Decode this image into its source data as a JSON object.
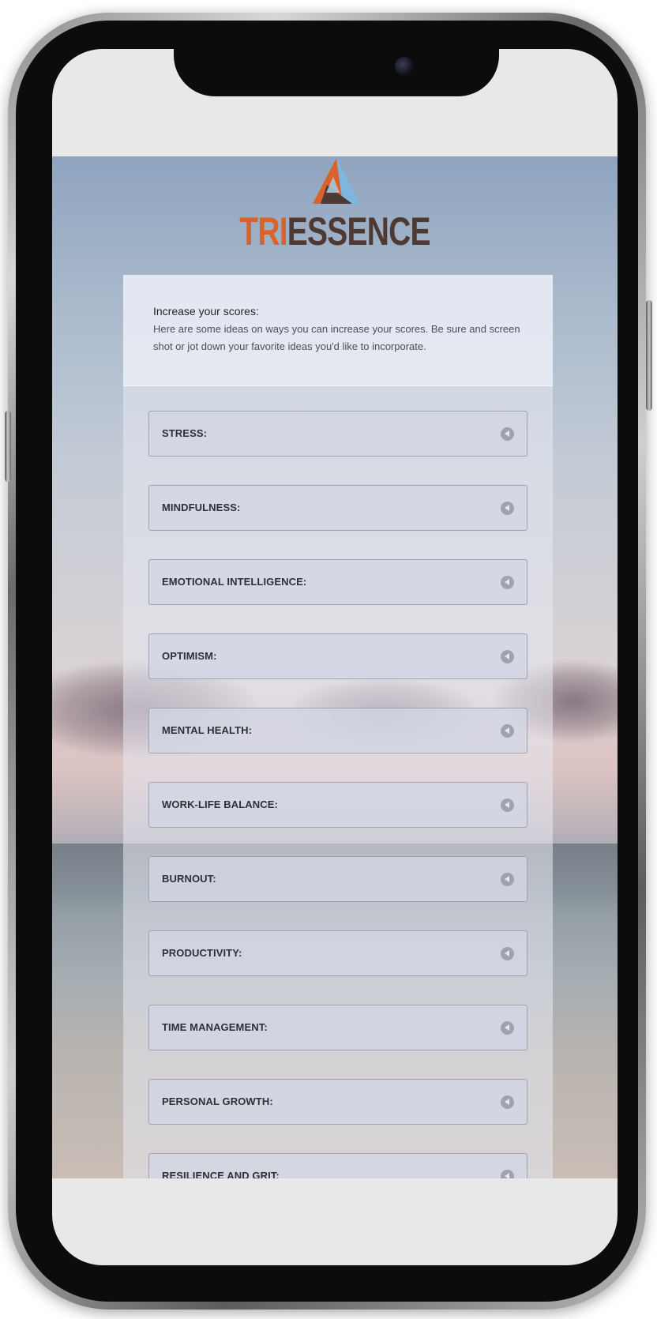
{
  "brand": {
    "name_part1": "TRI",
    "name_part2": "ESSENCE",
    "colors": {
      "accent_orange": "#d8642c",
      "accent_blue": "#7fb6e0",
      "brown": "#4e3a33"
    },
    "logo_icon": "triangle-logo-icon"
  },
  "intro": {
    "title": "Increase your scores:",
    "body": "Here are some ideas on ways you can increase your scores. Be sure and screen shot or jot down your favorite ideas you'd like to incorporate."
  },
  "accordion": {
    "expand_icon": "chevron-left-icon",
    "items": [
      {
        "label": "STRESS:"
      },
      {
        "label": "MINDFULNESS:"
      },
      {
        "label": "EMOTIONAL INTELLIGENCE:"
      },
      {
        "label": "OPTIMISM:"
      },
      {
        "label": "MENTAL HEALTH:"
      },
      {
        "label": "WORK-LIFE BALANCE:"
      },
      {
        "label": "BURNOUT:"
      },
      {
        "label": "PRODUCTIVITY:"
      },
      {
        "label": "TIME MANAGEMENT:"
      },
      {
        "label": "PERSONAL GROWTH:"
      },
      {
        "label": "RESILIENCE AND GRIT:"
      }
    ]
  }
}
